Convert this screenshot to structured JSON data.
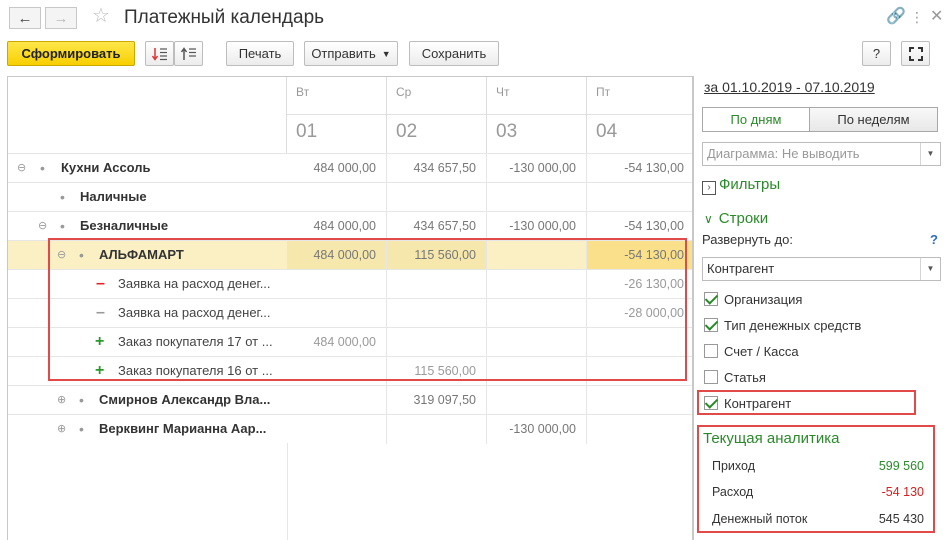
{
  "window": {
    "title": "Платежный календарь",
    "back_icon": "arrow-left-icon",
    "forward_icon": "arrow-right-icon",
    "favorite_icon": "star-icon",
    "link_icon": "link-icon",
    "menu_icon": "more-icon",
    "close_icon": "close-icon"
  },
  "toolbar": {
    "generate_label": "Сформировать",
    "print_label": "Печать",
    "send_label": "Отправить",
    "save_label": "Сохранить",
    "help_label": "?"
  },
  "table": {
    "columns": [
      {
        "day": "Вт",
        "date": "01"
      },
      {
        "day": "Ср",
        "date": "02"
      },
      {
        "day": "Чт",
        "date": "03"
      },
      {
        "day": "Пт",
        "date": "04"
      }
    ],
    "rows": [
      {
        "label": "Кухни Ассоль",
        "values": [
          "484 000,00",
          "434 657,50",
          "-130 000,00",
          "-54 130,00"
        ]
      },
      {
        "label": "Наличные",
        "values": [
          "",
          "",
          "",
          ""
        ]
      },
      {
        "label": "Безналичные",
        "values": [
          "484 000,00",
          "434 657,50",
          "-130 000,00",
          "-54 130,00"
        ]
      },
      {
        "label": "АЛЬФАМАРТ",
        "values": [
          "484 000,00",
          "115 560,00",
          "",
          "-54 130,00"
        ]
      },
      {
        "label": "Заявка на расход денег...",
        "values": [
          "",
          "",
          "",
          "-26 130,00"
        ]
      },
      {
        "label": "Заявка на расход денег...",
        "values": [
          "",
          "",
          "",
          "-28 000,00"
        ]
      },
      {
        "label": "Заказ покупателя 17 от ...",
        "values": [
          "484 000,00",
          "",
          "",
          ""
        ]
      },
      {
        "label": "Заказ покупателя 16 от ...",
        "values": [
          "",
          "115 560,00",
          "",
          ""
        ]
      },
      {
        "label": "Смирнов Александр Вла...",
        "values": [
          "",
          "319 097,50",
          "",
          ""
        ]
      },
      {
        "label": "Верквинг Марианна Аар...",
        "values": [
          "",
          "",
          "-130 000,00",
          ""
        ]
      }
    ]
  },
  "panel": {
    "period": "за 01.10.2019 - 07.10.2019",
    "by_days": "По дням",
    "by_weeks": "По неделям",
    "diagram": "Диаграмма: Не выводить",
    "filters": "Фильтры",
    "rows_section": "Строки",
    "expand_to": "Развернуть до:",
    "help": "?",
    "expand_value": "Контрагент",
    "checkboxes": [
      {
        "label": "Организация",
        "checked": true
      },
      {
        "label": "Тип денежных средств",
        "checked": true
      },
      {
        "label": "Счет / Касса",
        "checked": false
      },
      {
        "label": "Статья",
        "checked": false
      },
      {
        "label": "Контрагент",
        "checked": true
      }
    ],
    "analytics_title": "Текущая аналитика",
    "analytics": [
      {
        "label": "Приход",
        "value": "599 560",
        "color": "#2a8a2a"
      },
      {
        "label": "Расход",
        "value": "-54 130",
        "color": "#d62020"
      },
      {
        "label": "Денежный поток",
        "value": "545 430",
        "color": "#333333"
      }
    ]
  }
}
